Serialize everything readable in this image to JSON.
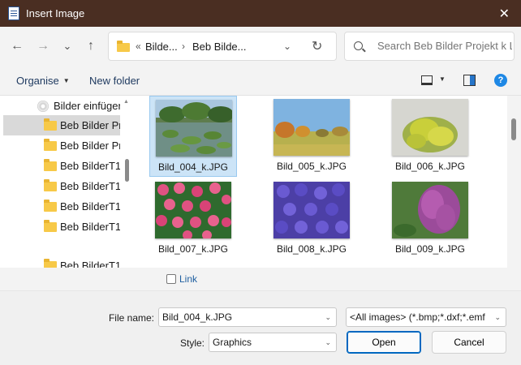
{
  "window": {
    "title": "Insert Image",
    "close_glyph": "✕"
  },
  "nav": {
    "back_glyph": "←",
    "forward_glyph": "→",
    "recent_glyph": "⌄",
    "up_glyph": "↑",
    "address": {
      "overflow": "«",
      "crumb1": "Bilde...",
      "sep": "›",
      "crumb2": "Beb Bilde...",
      "dropdown_glyph": "⌄",
      "refresh_glyph": "↻"
    },
    "search": {
      "placeholder": "Search Beb Bilder Projekt k L..."
    }
  },
  "toolbar": {
    "organise": "Organise",
    "new_folder": "New folder",
    "help": "?"
  },
  "tree": {
    "items": [
      {
        "label": "Bilder einfügen",
        "type": "drive"
      },
      {
        "label": "Beb Bilder Projekt",
        "type": "folder",
        "selected": true
      },
      {
        "label": "Beb Bilder Projekt",
        "type": "folder"
      },
      {
        "label": "Beb BilderT1",
        "type": "folder"
      },
      {
        "label": "Beb BilderT1",
        "type": "folder"
      },
      {
        "label": "Beb BilderT1",
        "type": "folder"
      },
      {
        "label": "Beb BilderT1",
        "type": "folder"
      },
      {
        "label": "Beb BilderT1",
        "type": "folder"
      }
    ]
  },
  "files": [
    {
      "name": "Bild_004_k.JPG",
      "selected": true,
      "thumb": "water-lilies"
    },
    {
      "name": "Bild_005_k.JPG",
      "thumb": "autumn-field"
    },
    {
      "name": "Bild_006_k.JPG",
      "thumb": "yellow-blossoms"
    },
    {
      "name": "Bild_007_k.JPG",
      "thumb": "pink-daisies"
    },
    {
      "name": "Bild_008_k.JPG",
      "thumb": "purple-violets"
    },
    {
      "name": "Bild_009_k.JPG",
      "thumb": "lilac"
    }
  ],
  "options": {
    "link_label": "Link"
  },
  "form": {
    "filename_label": "File name:",
    "filename_value": "Bild_004_k.JPG",
    "filetype_value": "<All images> (*.bmp;*.dxf;*.emf",
    "style_label": "Style:",
    "style_value": "Graphics",
    "open_button": "Open",
    "cancel_button": "Cancel",
    "dropdown_glyph": "⌄"
  },
  "colors": {
    "titlebar": "#4a2e22",
    "accent": "#0067c0",
    "selection": "#cce4f7"
  }
}
